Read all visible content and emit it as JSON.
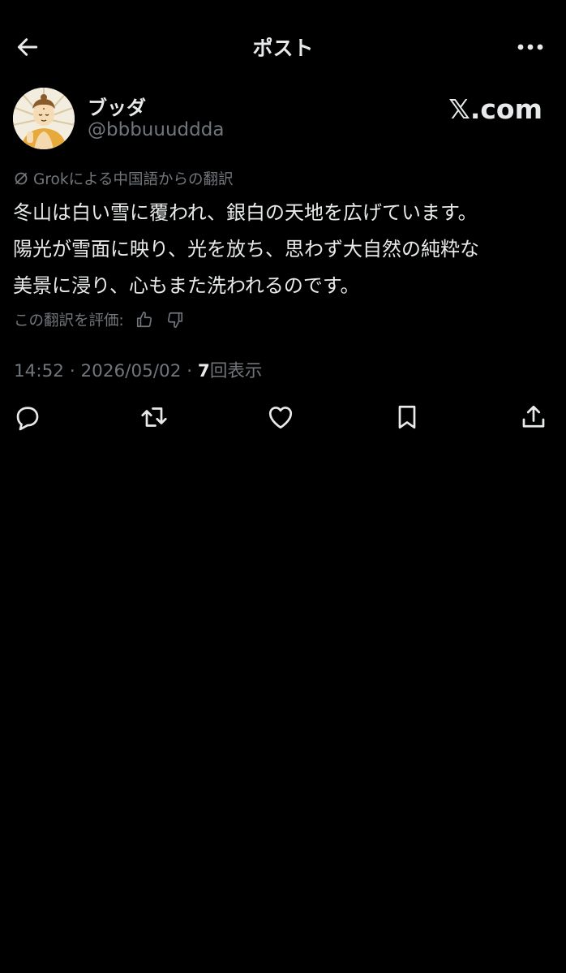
{
  "header": {
    "title": "ポスト"
  },
  "post": {
    "display_name": "ブッダ",
    "handle": "@bbbuuuddda",
    "watermark": "𝕏.com",
    "translation_note": "Grokによる中国語からの翻訳",
    "body_lines": [
      "冬山は白い雪に覆われ、銀白の天地を広げています。",
      "陽光が雪面に映り、光を放ち、思わず大自然の純粋な",
      "美景に浸り、心もまた洗われるのです。"
    ],
    "rate_label": "この翻訳を評価:",
    "time": "14:52",
    "separator": "·",
    "date": "2026/05/02",
    "views_count": "7",
    "views_label": "回表示"
  },
  "icons": {
    "back": "arrow-left-icon",
    "more": "more-horizontal-icon",
    "grok": "grok-icon",
    "thumbs_up": "thumbs-up-icon",
    "thumbs_down": "thumbs-down-icon",
    "reply": "reply-icon",
    "repost": "repost-icon",
    "like": "heart-icon",
    "bookmark": "bookmark-icon",
    "share": "share-icon"
  },
  "colors": {
    "background": "#000000",
    "primary_text": "#e7e9ea",
    "secondary_text": "#71767b"
  }
}
